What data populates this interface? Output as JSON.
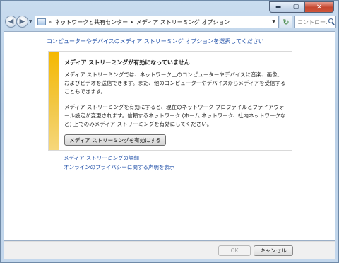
{
  "window": {
    "caption": {
      "minimize_glyph": "▬",
      "maximize_glyph": "▢",
      "close_glyph": "✕"
    }
  },
  "nav": {
    "back_glyph": "◀",
    "forward_glyph": "▶",
    "breadcrumb": {
      "overflow": "«",
      "items": [
        "ネットワークと共有センター",
        "メディア ストリーミング オプション"
      ],
      "separator": "▸"
    },
    "refresh_glyph": "↻",
    "search_placeholder": "コントロー..."
  },
  "content": {
    "intro": "コンピューターやデバイスのメディア ストリーミング オプションを選択してください",
    "panel": {
      "accent_color": "#f5b800",
      "title": "メディア ストリーミングが有効になっていません",
      "paragraph1": "メディア ストリーミングでは、ネットワーク上のコンピューターやデバイスに音楽、画像、およびビデオを送信できます。また、他のコンピューターやデバイスからメディアを受信することもできます。",
      "paragraph2": "メディア ストリーミングを有効にすると、現在のネットワーク プロファイルとファイアウォール設定が変更されます。信頼するネットワーク (ホーム ネットワーク、社内ネットワークなど) 上でのみメディア ストリーミングを有効にしてください。",
      "enable_button": "メディア ストリーミングを有効にする"
    },
    "links": {
      "details": "メディア ストリーミングの詳細",
      "privacy": "オンラインのプライバシーに関する声明を表示"
    }
  },
  "footer": {
    "ok_label": "OK",
    "cancel_label": "キャンセル"
  }
}
